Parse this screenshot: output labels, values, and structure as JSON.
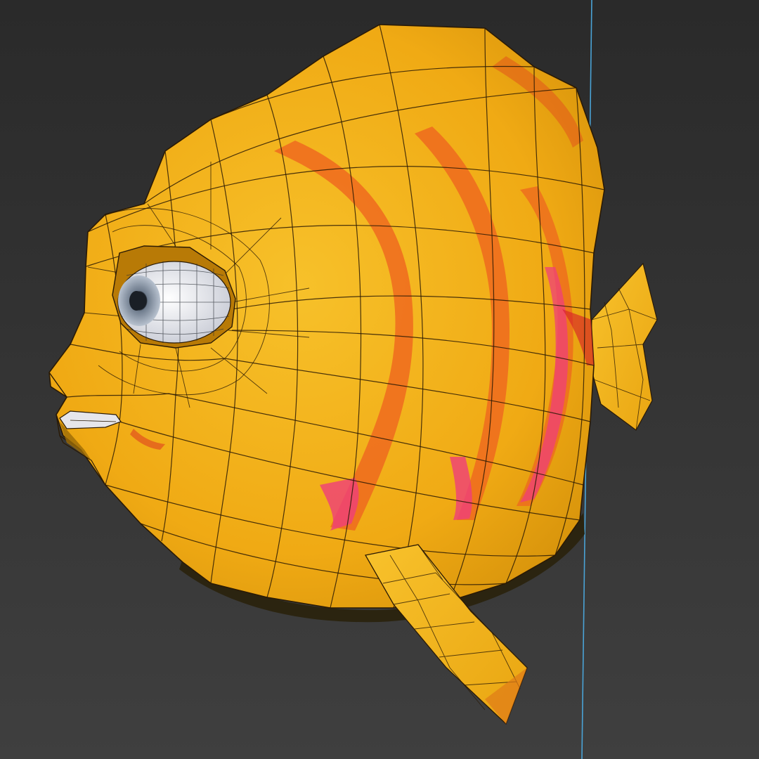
{
  "viewport": {
    "background_top": "#2a2a2a",
    "background_bottom": "#3f3f3f",
    "guide_line_color": "#4aa3d6"
  },
  "model": {
    "body_color": "#f2b41a",
    "body_shade_color": "#d9950c",
    "stripe_color": "#ee6a1e",
    "stripe_highlight_color": "#ef3f7a",
    "wire_color": "#2a1a05",
    "eye_white_color": "#e8e8ee",
    "eye_iris_color": "#9aa6b5",
    "eye_pupil_color": "#1a1f26"
  }
}
